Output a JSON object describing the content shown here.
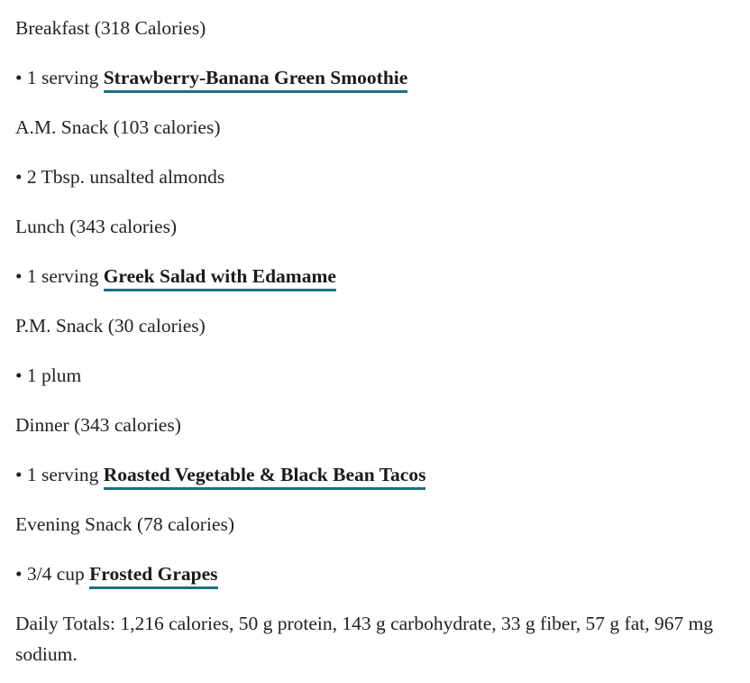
{
  "meal_plan": {
    "breakfast": {
      "heading": "Breakfast (318 Calories)",
      "item_prefix": "• 1 serving ",
      "item_link": "Strawberry-Banana Green Smoothie"
    },
    "am_snack": {
      "heading": "A.M. Snack (103 calories)",
      "item_text": "• 2 Tbsp. unsalted almonds"
    },
    "lunch": {
      "heading": "Lunch (343 calories)",
      "item_prefix": "• 1 serving ",
      "item_link": "Greek Salad with Edamame"
    },
    "pm_snack": {
      "heading": "P.M. Snack (30 calories)",
      "item_text": "• 1 plum"
    },
    "dinner": {
      "heading": "Dinner (343 calories)",
      "item_prefix": "• 1 serving ",
      "item_link": "Roasted Vegetable & Black Bean Tacos"
    },
    "evening_snack": {
      "heading": "Evening Snack (78 calories)",
      "item_prefix": "• 3/4 cup ",
      "item_link": "Frosted Grapes"
    },
    "daily_totals": "Daily Totals: 1,216 calories, 50 g protein, 143 g carbohydrate, 33 g fiber, 57 g fat, 967 mg sodium."
  },
  "colors": {
    "text": "#222222",
    "link_underline": "#1b7083"
  }
}
